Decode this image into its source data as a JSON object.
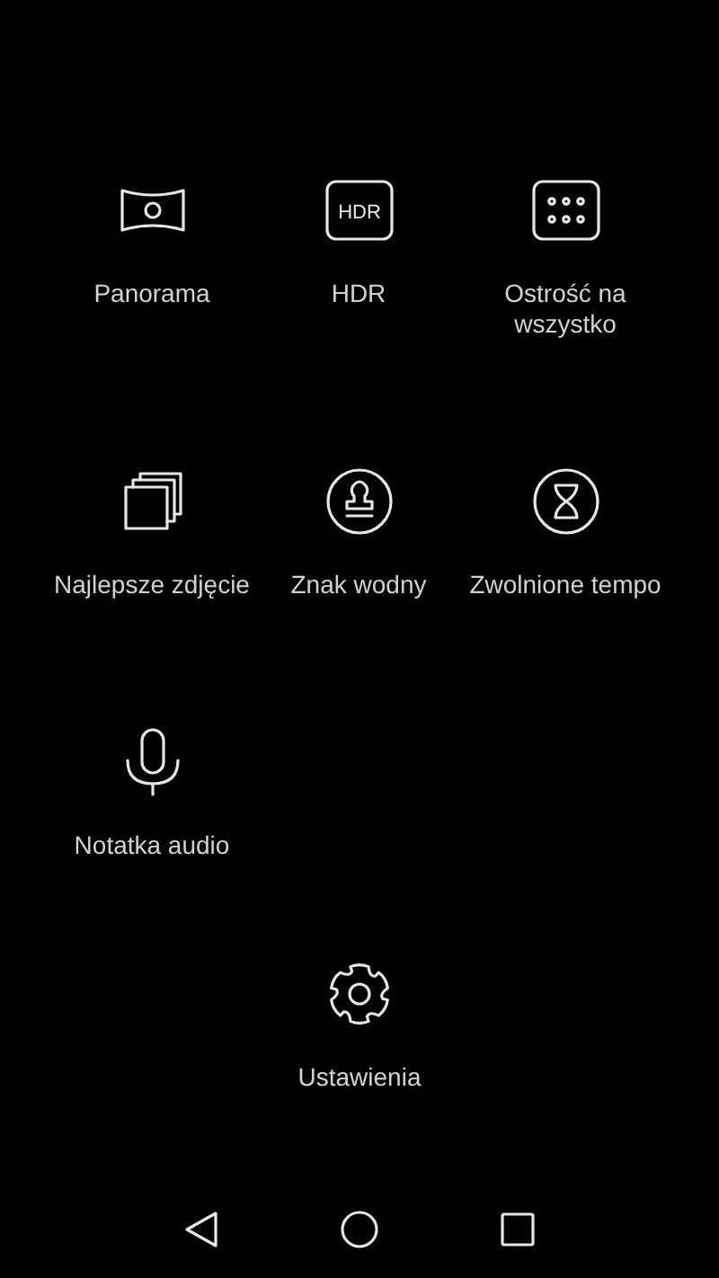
{
  "modes": [
    {
      "kind": "panorama",
      "label": "Panorama"
    },
    {
      "kind": "hdr",
      "badge": "HDR",
      "label": "HDR"
    },
    {
      "kind": "allfocus",
      "label": "Ostrość na wszystko"
    },
    {
      "kind": "bestphoto",
      "label": "Najlepsze zdjęcie"
    },
    {
      "kind": "watermark",
      "label": "Znak wodny"
    },
    {
      "kind": "slowmo",
      "label": "Zwolnione tempo"
    },
    {
      "kind": "audio",
      "label": "Notatka audio"
    }
  ],
  "settings": {
    "label": "Ustawienia"
  }
}
